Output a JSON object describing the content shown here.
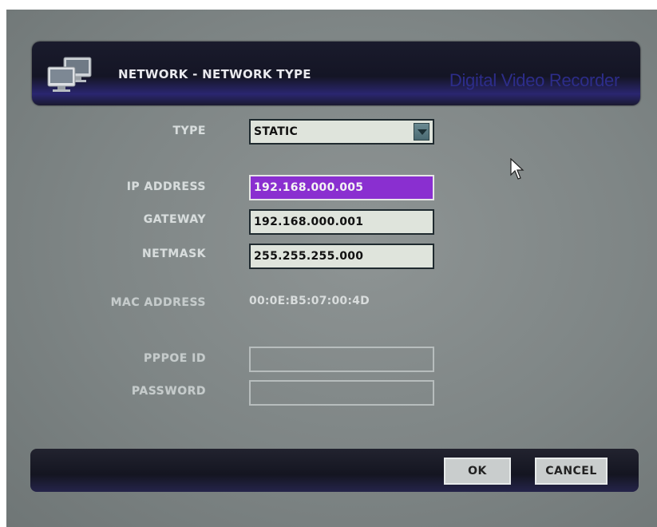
{
  "header": {
    "title": "NETWORK - NETWORK TYPE",
    "brand": "Digital Video Recorder",
    "icon": "network-computers-icon"
  },
  "form": {
    "type": {
      "label": "TYPE",
      "value": "STATIC"
    },
    "ip_address": {
      "label": "IP ADDRESS",
      "value": "192.168.000.005"
    },
    "gateway": {
      "label": "GATEWAY",
      "value": "192.168.000.001"
    },
    "netmask": {
      "label": "NETMASK",
      "value": "255.255.255.000"
    },
    "mac_address": {
      "label": "MAC ADDRESS",
      "value": "00:0E:B5:07:00:4D"
    },
    "pppoe_id": {
      "label": "PPPOE ID",
      "value": ""
    },
    "password": {
      "label": "PASSWORD",
      "value": ""
    }
  },
  "footer": {
    "ok_label": "OK",
    "cancel_label": "CANCEL"
  },
  "colors": {
    "selected_field": "#8a2fd0",
    "field_bg": "#dfe4dc",
    "panel_dark": "#141525",
    "brand_text": "#2d2d8a"
  }
}
